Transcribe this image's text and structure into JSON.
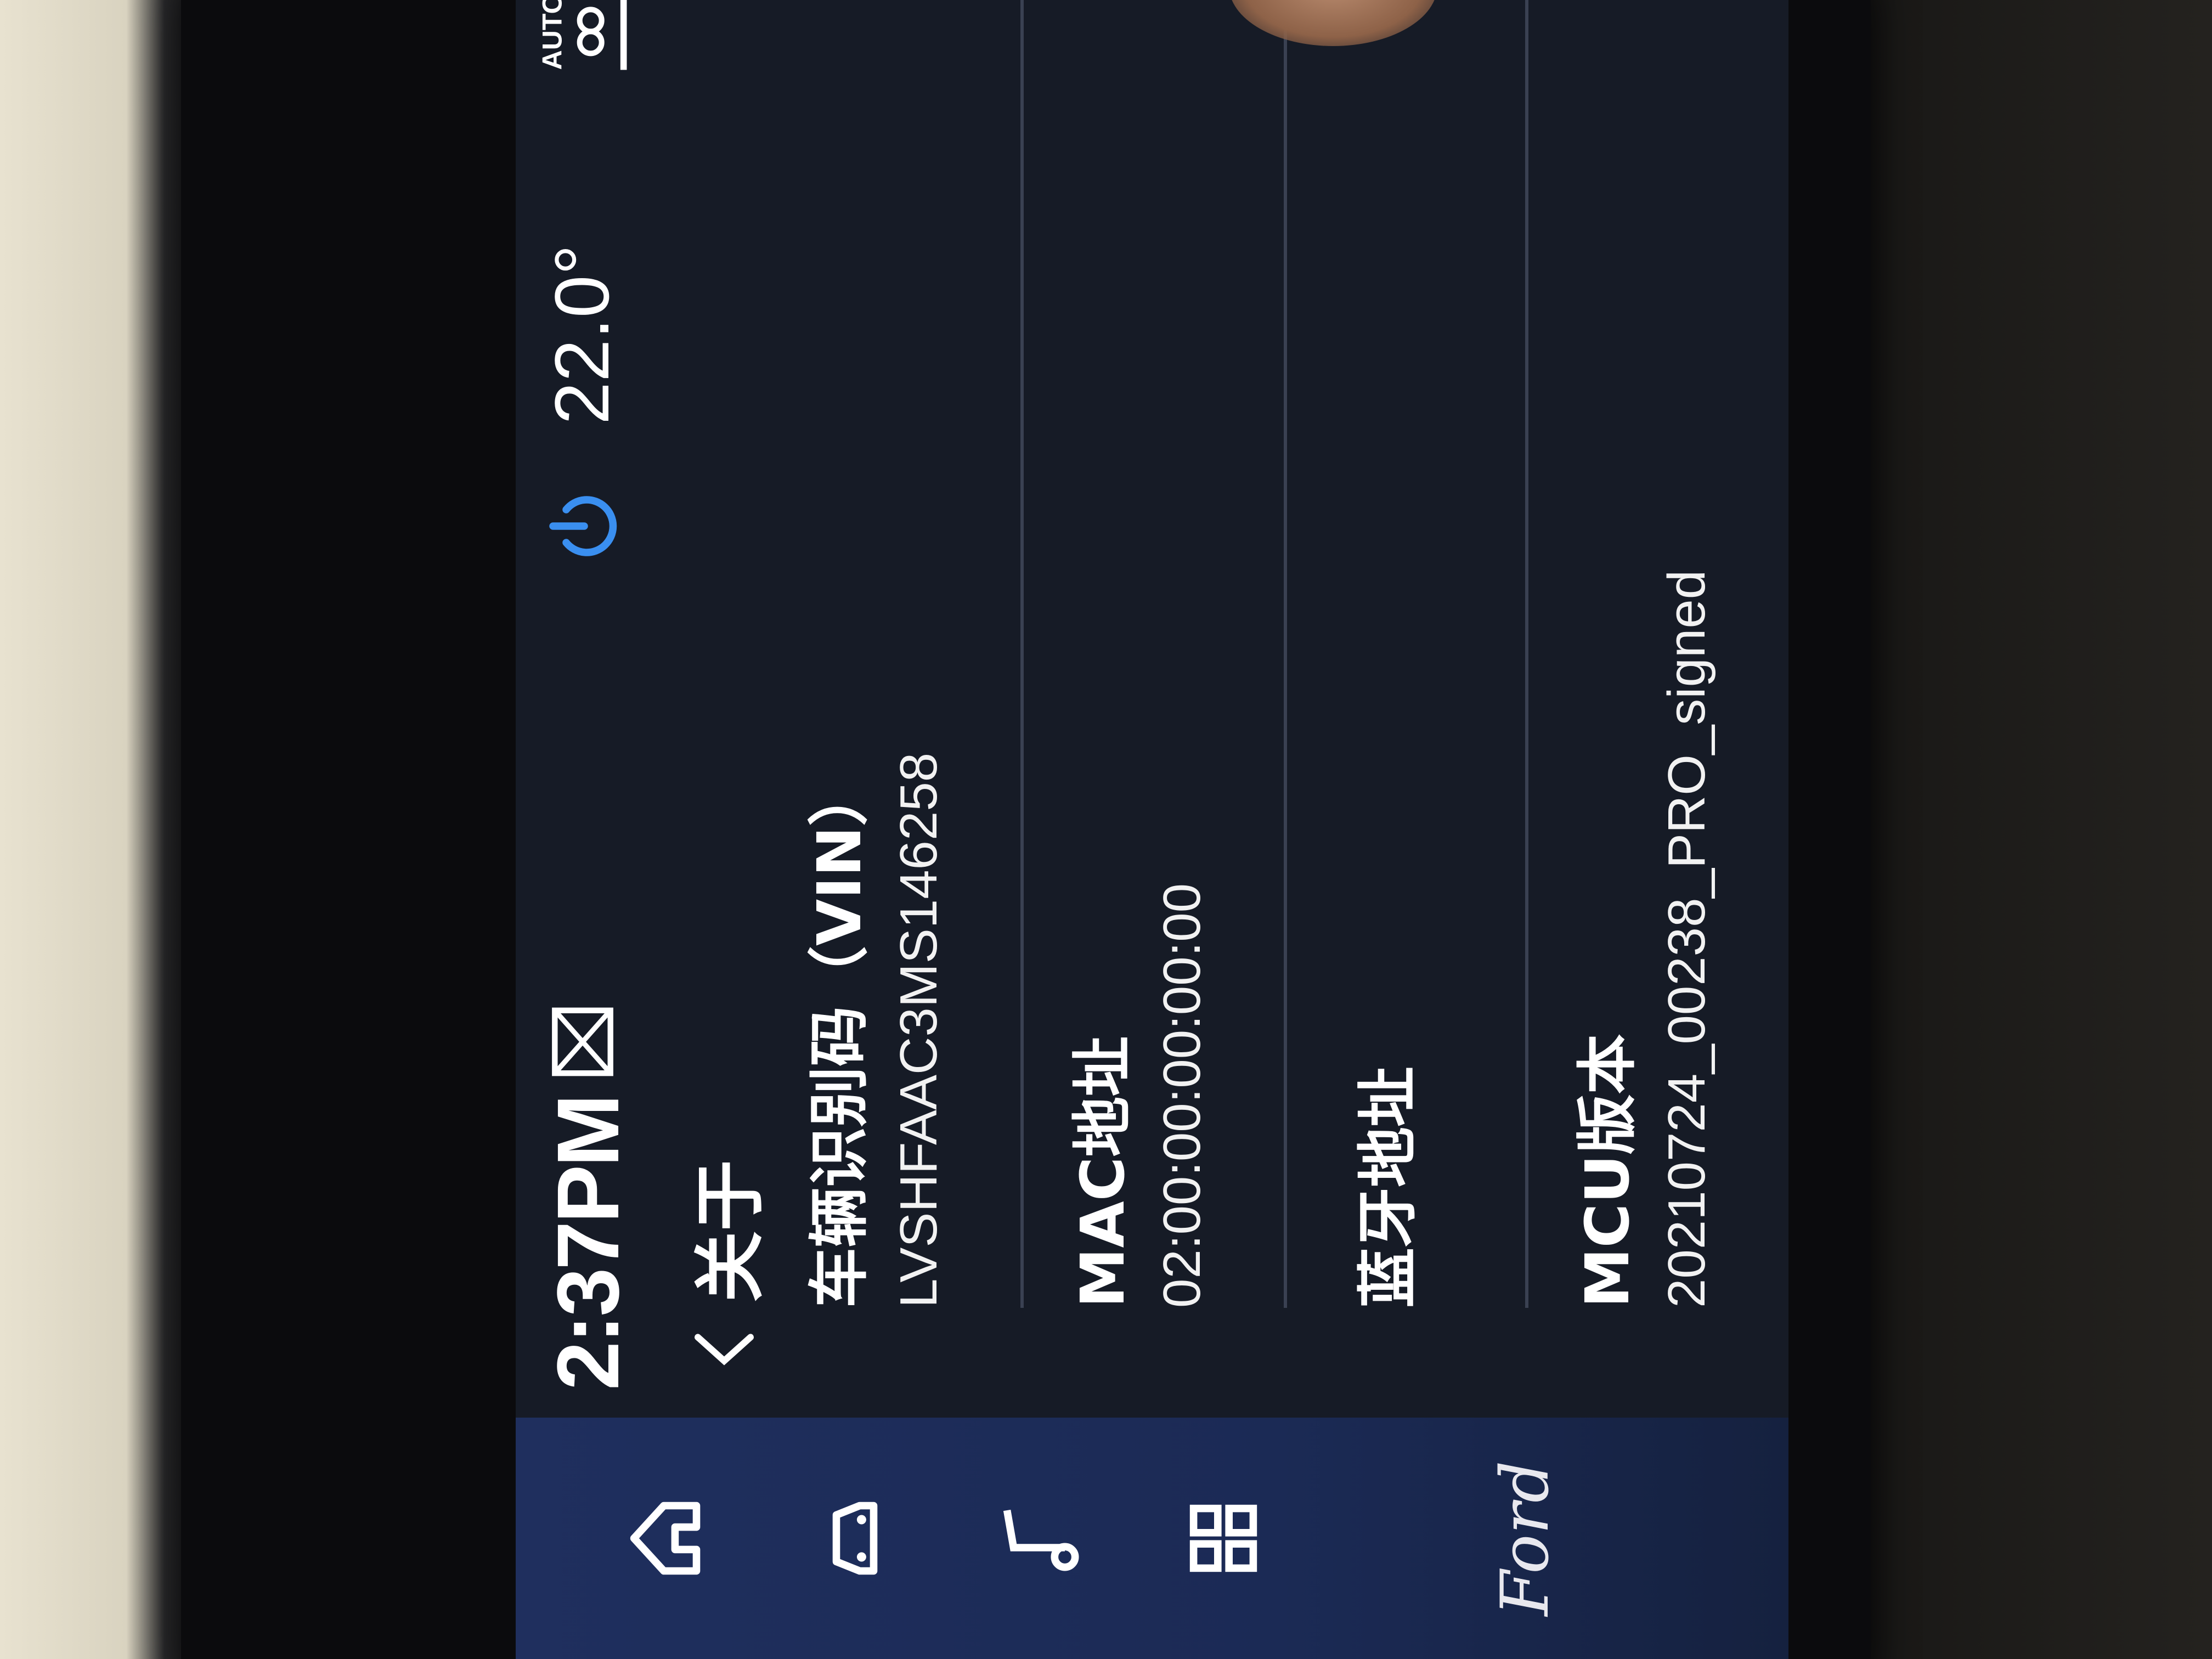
{
  "status_bar": {
    "time": "2:37PM",
    "temperature": "22.0°",
    "fan_label": "AUTO"
  },
  "page": {
    "title": "关于"
  },
  "rows": [
    {
      "label": "车辆识别码（VIN）",
      "value": "LVSHFAAC3MS146258"
    },
    {
      "label": "MAC地址",
      "value": "02:00:00:00:00:00"
    },
    {
      "label": "蓝牙地址",
      "value": ""
    },
    {
      "label": "MCU版本",
      "value": "20210724_00238_PRO_signed"
    }
  ],
  "nav": {
    "items": [
      "home-icon",
      "vehicle-icon",
      "music-icon",
      "apps-icon"
    ],
    "brand": "Ford"
  },
  "colors": {
    "nav_rail": "#1f2f5e",
    "power_accent": "#3a8ff0",
    "background": "#161b26"
  }
}
